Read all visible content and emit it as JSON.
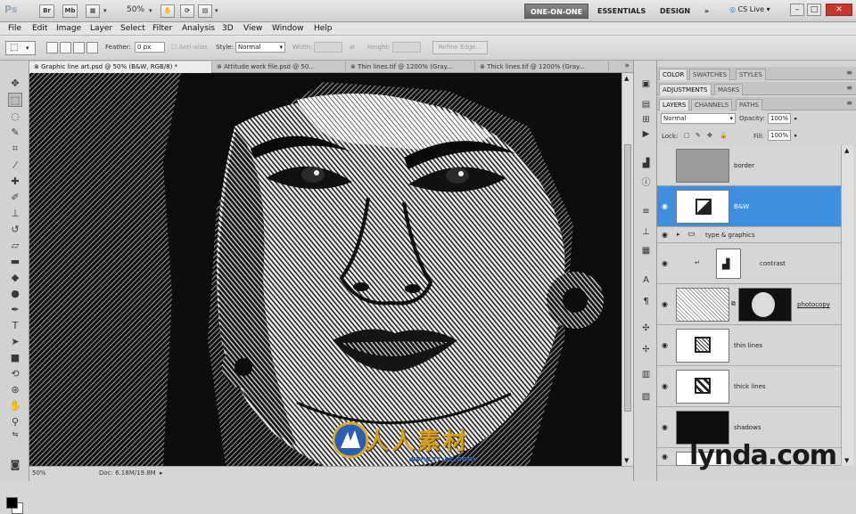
{
  "app": {
    "logo": "Ps",
    "app_buttons": [
      "Br",
      "Mb"
    ],
    "zoom_level": "50%",
    "workspaces": [
      "ONE-ON-ONE",
      "ESSENTIALS",
      "DESIGN"
    ],
    "more_label": "»",
    "cs_live": "CS Live",
    "window_controls": [
      "–",
      "□",
      "✕"
    ]
  },
  "menu": [
    "File",
    "Edit",
    "Image",
    "Layer",
    "Select",
    "Filter",
    "Analysis",
    "3D",
    "View",
    "Window",
    "Help"
  ],
  "options": {
    "feather_label": "Feather:",
    "feather_value": "0 px",
    "antialias_label": "Anti-alias",
    "style_label": "Style:",
    "style_value": "Normal",
    "width_label": "Width:",
    "height_label": "Height:",
    "refine_label": "Refine Edge..."
  },
  "doc_tabs": [
    "Graphic line art.psd @ 50% (B&W, RGB/8) *",
    "Attitude work file.psd @ 50...",
    "Thin lines.tif @ 1200% (Gray...",
    "Thick lines.tif @ 1200% (Gray..."
  ],
  "status": {
    "zoom": "50%",
    "doc_info": "Doc: 6.18M/19.8M"
  },
  "panels": {
    "group1_tabs": [
      "COLOR",
      "SWATCHES",
      "STYLES"
    ],
    "group2_tabs": [
      "ADJUSTMENTS",
      "MASKS"
    ],
    "group3_tabs": [
      "LAYERS",
      "CHANNELS",
      "PATHS"
    ],
    "blend_mode": "Normal",
    "opacity_label": "Opacity:",
    "opacity_value": "100%",
    "lock_label": "Lock:",
    "fill_label": "Fill:",
    "fill_value": "100%"
  },
  "layers": [
    {
      "name": "border",
      "visible": false,
      "selected": false
    },
    {
      "name": "B&W",
      "visible": true,
      "selected": true
    },
    {
      "name": "type & graphics",
      "visible": true,
      "selected": false,
      "group": true
    },
    {
      "name": "contrast",
      "visible": true,
      "selected": false
    },
    {
      "name": "photocopy",
      "visible": true,
      "selected": false
    },
    {
      "name": "thin lines",
      "visible": true,
      "selected": false
    },
    {
      "name": "thick lines",
      "visible": true,
      "selected": false
    },
    {
      "name": "shadows",
      "visible": true,
      "selected": false
    }
  ],
  "watermark": {
    "brand": "lynda.com",
    "cn_text": "人人素材",
    "cn_url": "www.rr-sc.com"
  },
  "colors": {
    "selection_blue": "#3f8fdf",
    "workspace_active": "#6a6a6a",
    "close_red": "#c8372d",
    "watermark_gold": "#d3a126"
  }
}
